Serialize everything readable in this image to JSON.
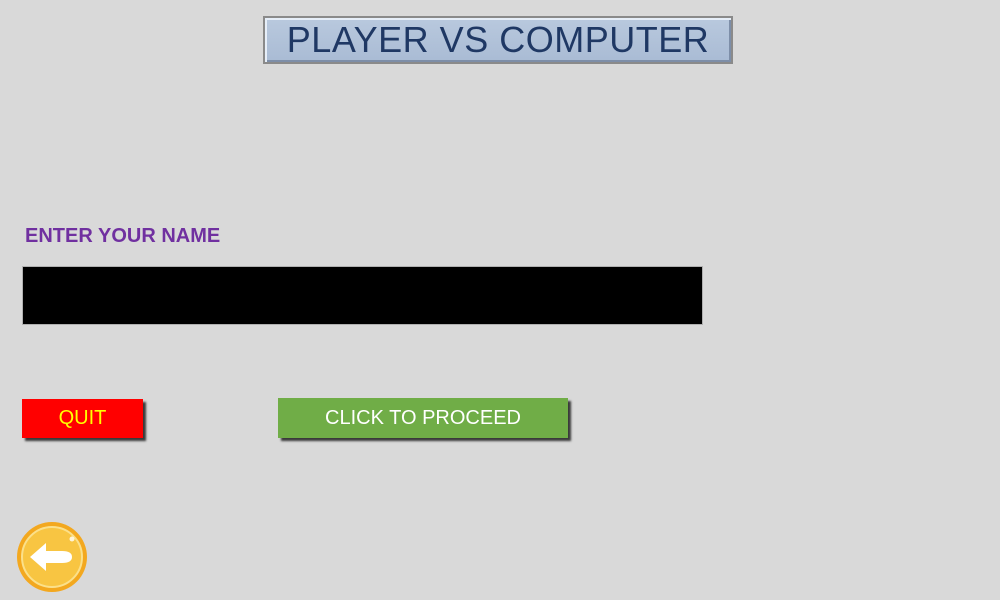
{
  "header": {
    "title": "PLAYER VS COMPUTER"
  },
  "name_form": {
    "label": "ENTER YOUR NAME",
    "value": "",
    "placeholder": ""
  },
  "actions": {
    "quit_label": "QUIT",
    "proceed_label": "CLICK TO PROCEED"
  },
  "icons": {
    "back": "back-arrow-icon"
  },
  "colors": {
    "background": "#d9d9d9",
    "title_text": "#1f3864",
    "title_bg": "#b4c7e7",
    "label_text": "#7030a0",
    "input_bg": "#000000",
    "quit_bg": "#ff0000",
    "quit_text": "#ffff00",
    "proceed_bg": "#70ad47",
    "proceed_text": "#ffffff",
    "back_button": "#f5b325"
  }
}
